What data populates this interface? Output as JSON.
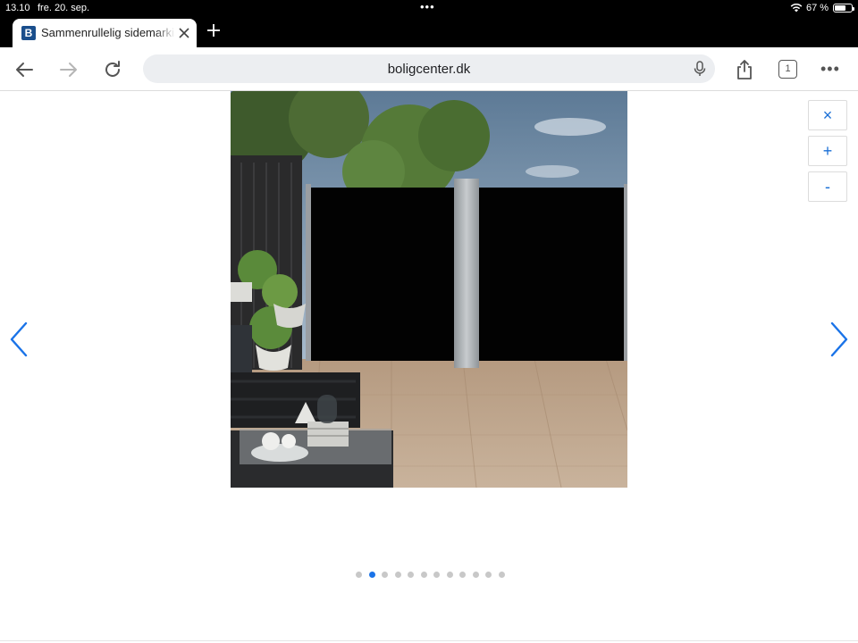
{
  "status_bar": {
    "time": "13.10",
    "date": "fre. 20. sep.",
    "battery_percent": "67 %",
    "battery_level": 0.67,
    "multitask_dots": "•••"
  },
  "tab": {
    "title": "Sammenrullelig sidemarkise",
    "favicon_letter": "B"
  },
  "toolbar": {
    "url": "boligcenter.dk",
    "tab_count": "1",
    "more": "•••"
  },
  "gallery": {
    "zoom_close": "×",
    "zoom_in": "+",
    "zoom_out": "-",
    "active_index": 1,
    "total_images": 12
  },
  "colors": {
    "accent": "#1a73e8",
    "favicon": "#1a4e8c"
  }
}
